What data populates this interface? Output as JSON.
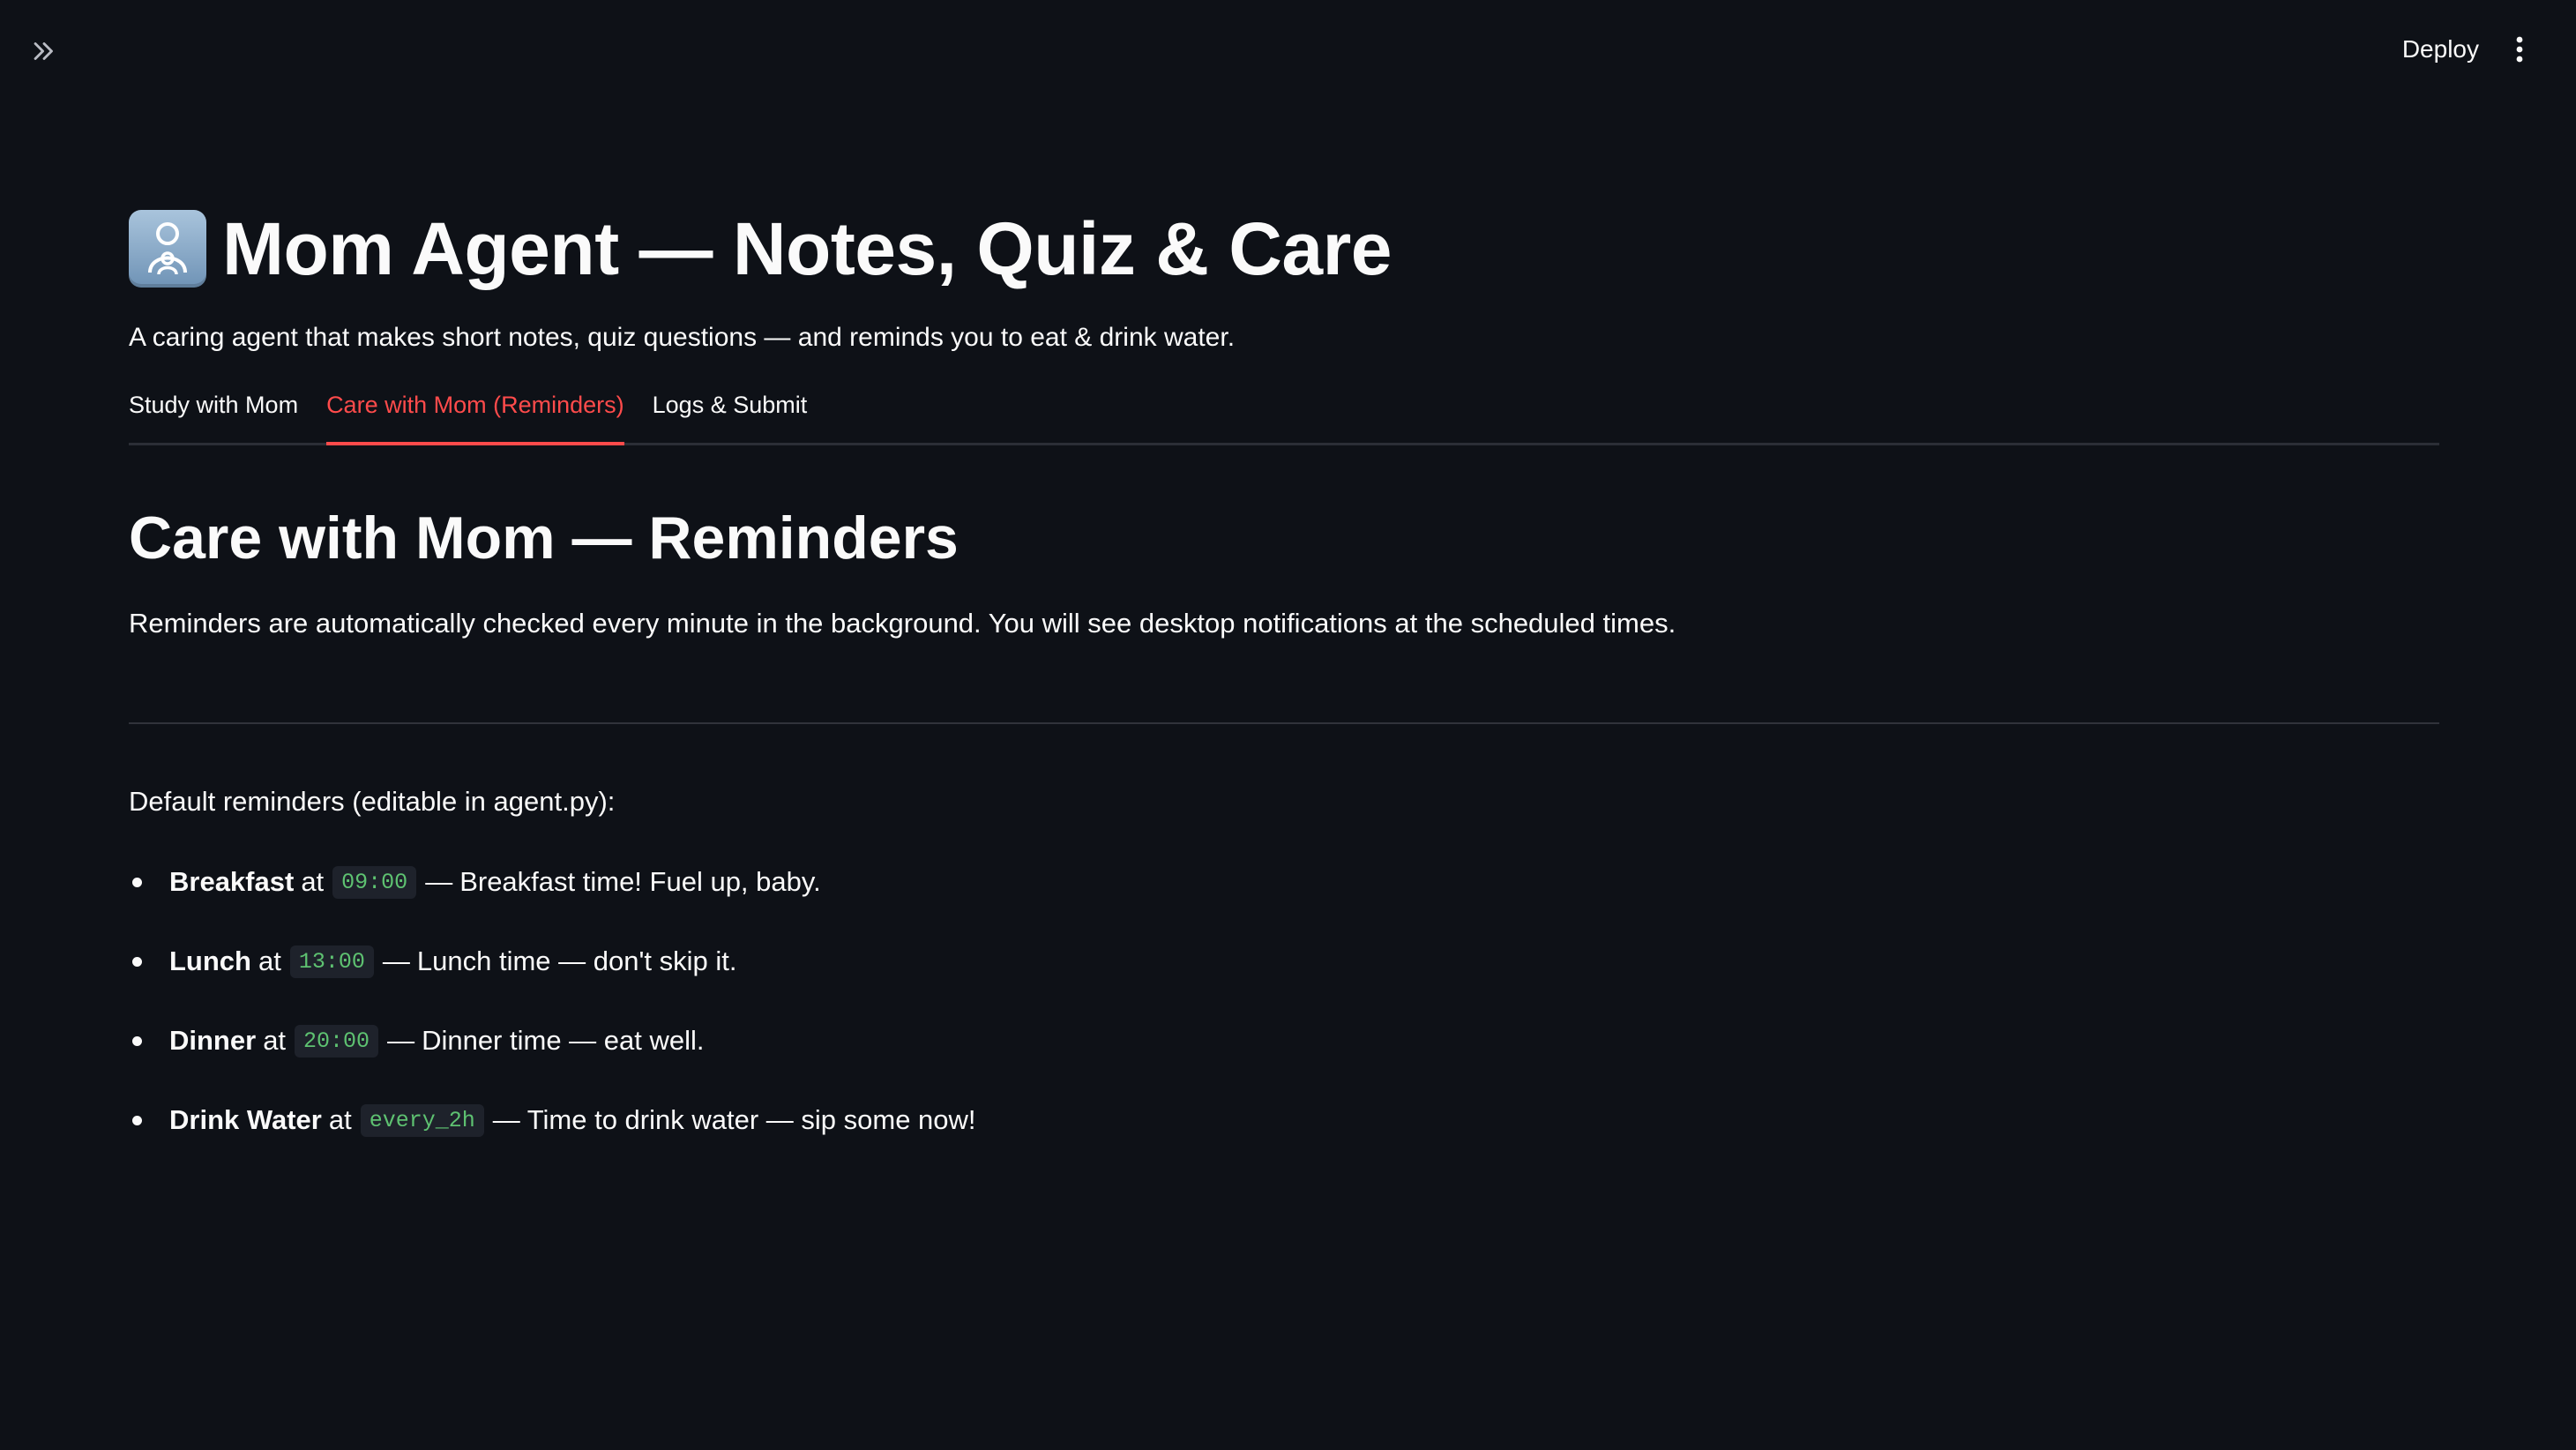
{
  "header": {
    "deploy_label": "Deploy"
  },
  "page": {
    "title": "Mom Agent — Notes, Quiz & Care",
    "subtitle": "A caring agent that makes short notes, quiz questions — and reminds you to eat & drink water."
  },
  "tabs": [
    {
      "label": "Study with Mom",
      "active": false
    },
    {
      "label": "Care with Mom (Reminders)",
      "active": true
    },
    {
      "label": "Logs & Submit",
      "active": false
    }
  ],
  "care": {
    "heading": "Care with Mom — Reminders",
    "info": "Reminders are automatically checked every minute in the background. You will see desktop notifications at the scheduled times.",
    "defaults_label": "Default reminders (editable in agent.py):",
    "at_word": "at",
    "separator": "—",
    "reminders": [
      {
        "name": "Breakfast",
        "time": "09:00",
        "message": "Breakfast time! Fuel up, baby."
      },
      {
        "name": "Lunch",
        "time": "13:00",
        "message": "Lunch time — don't skip it."
      },
      {
        "name": "Dinner",
        "time": "20:00",
        "message": "Dinner time — eat well."
      },
      {
        "name": "Drink Water",
        "time": "every_2h",
        "message": "Time to drink water — sip some now!"
      }
    ]
  },
  "colors": {
    "background": "#0e1117",
    "accent": "#ff4b4b",
    "code_text": "#5ec271",
    "code_bg": "#1e222b"
  },
  "icons": {
    "sidebar_toggle": "double-chevron-right-icon",
    "menu": "vertical-dots-icon",
    "title_emoji": "woman-with-baby-emoji-icon"
  }
}
